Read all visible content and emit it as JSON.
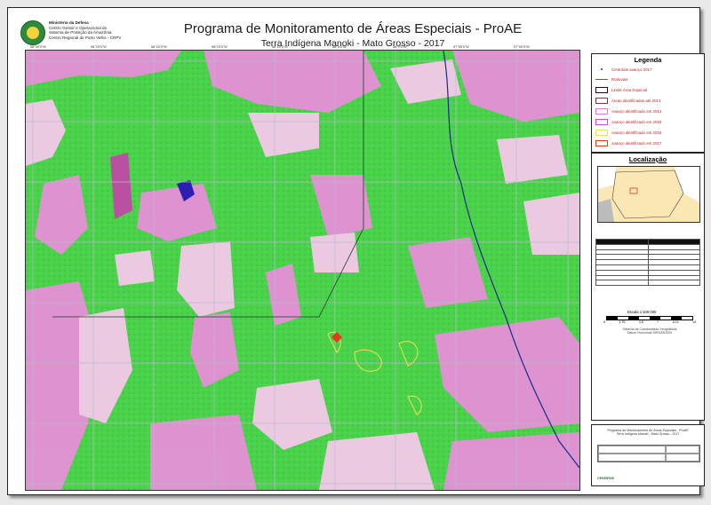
{
  "header": {
    "org_lines": [
      "Ministério da Defesa",
      "Centro Gestor e Operacional do",
      "Sistema de Proteção da Amazônia",
      "Centro Regional de Porto Velho - CRPV"
    ],
    "title": "Programa de Monitoramento de Áreas Especiais - ProAE",
    "subtitle": "Terra Indígena Manoki - Mato Grosso - 2017"
  },
  "legend": {
    "title": "Legenda",
    "items": [
      {
        "label": "Centróide avanço 2017",
        "color": "#333333",
        "type": "dot"
      },
      {
        "label": "Rodovias",
        "color": "#cc3333",
        "type": "line"
      },
      {
        "label": "Limite Área Especial",
        "color": "#111111",
        "type": "box"
      },
      {
        "label": "Áreas identificadas até 2013",
        "color": "#7a3a3a",
        "type": "box"
      },
      {
        "label": "Avanço identificado em 2014",
        "color": "#e07ad8",
        "type": "box"
      },
      {
        "label": "Avanço identificado em 2015",
        "color": "#c84fd0",
        "type": "box"
      },
      {
        "label": "Avanço identificado em 2016",
        "color": "#f2e24a",
        "type": "box"
      },
      {
        "label": "Avanço identificado em 2017",
        "color": "#e23a1a",
        "type": "box"
      }
    ]
  },
  "location": {
    "title": "Localização"
  },
  "scale": {
    "label": "Escala 1:100.000",
    "ticks": [
      "0",
      "1,75",
      "3,5",
      "7",
      "10,5",
      "14"
    ]
  },
  "projection": [
    "Sistema de Coordenadas Geográficas",
    "Datum Horizontal SIRGAS2000"
  ],
  "footer": {
    "lines": [
      "Programa de Monitoramento de Áreas Especiais - ProAE",
      "Terra Indígena Manoki - Mato Grosso - 2017"
    ],
    "org": "CENSIPAM"
  },
  "colors": {
    "forest": "#49d24a",
    "cleared": "#e690d8",
    "cleared_light": "#f3c9ea",
    "grid": "#b9b9c9",
    "boundary": "#1c2a8a",
    "road": "#ff3333"
  }
}
